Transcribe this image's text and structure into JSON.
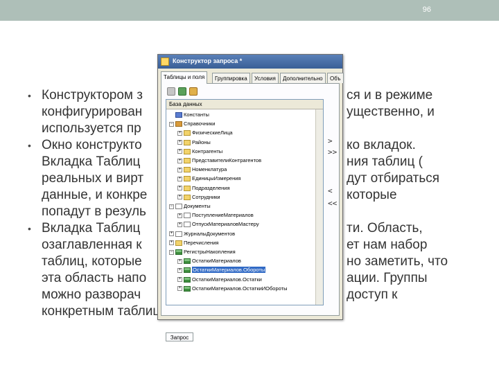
{
  "slide_number": "96",
  "bullets": [
    [
      "Конструктором з",
      "конфигурирован",
      "используется пр"
    ],
    [
      "Окно конструкто",
      "Вкладка Таблиц",
      "реальных и вирт",
      "данные, и конкре",
      "попадут в резуль"
    ],
    [
      "Вкладка Таблиц",
      "озаглавленная к",
      "таблиц, которые",
      "эта область напо",
      "можно разворач",
      "конкретным таблицам."
    ]
  ],
  "bullets_right": [
    [
      "ся и в режиме",
      "ущественно, и",
      ""
    ],
    [
      "ко вкладок.",
      "ния таблиц (",
      "дут отбираться",
      "которые",
      ""
    ],
    [
      "ти. Область,",
      "ет нам набор",
      "но заметить, что",
      "ации. Группы",
      "доступ к",
      ""
    ]
  ],
  "window": {
    "title": "Конструктор запроса *",
    "tabs": [
      "Таблицы и поля",
      "Группировка",
      "Условия",
      "Дополнительно",
      "Объ"
    ],
    "tree_header": "База данных",
    "bottom_tab": "Запрос",
    "tree": [
      {
        "label": "Константы",
        "icon": "const",
        "level": 1,
        "exp": ""
      },
      {
        "label": "Справочники",
        "icon": "book",
        "level": 1,
        "exp": "−"
      },
      {
        "label": "ФизическиеЛица",
        "icon": "folder",
        "level": 2,
        "exp": "+"
      },
      {
        "label": "Районы",
        "icon": "folder",
        "level": 2,
        "exp": "+"
      },
      {
        "label": "Контрагенты",
        "icon": "folder",
        "level": 2,
        "exp": "+"
      },
      {
        "label": "ПредставителиКонтрагентов",
        "icon": "folder",
        "level": 2,
        "exp": "+"
      },
      {
        "label": "Номенклатура",
        "icon": "folder",
        "level": 2,
        "exp": "+"
      },
      {
        "label": "ЕдиницыИзмерения",
        "icon": "folder",
        "level": 2,
        "exp": "+"
      },
      {
        "label": "Подразделения",
        "icon": "folder",
        "level": 2,
        "exp": "+"
      },
      {
        "label": "Сотрудники",
        "icon": "folder",
        "level": 2,
        "exp": "+"
      },
      {
        "label": "Документы",
        "icon": "doc",
        "level": 1,
        "exp": "−"
      },
      {
        "label": "ПоступлениеМатериалов",
        "icon": "doc",
        "level": 2,
        "exp": "+"
      },
      {
        "label": "ОтпускМатериаловМастеру",
        "icon": "doc",
        "level": 2,
        "exp": "+"
      },
      {
        "label": "ЖурналыДокументов",
        "icon": "doc",
        "level": 1,
        "exp": "+"
      },
      {
        "label": "Перечисления",
        "icon": "folder",
        "level": 1,
        "exp": "+"
      },
      {
        "label": "РегистрыНакопления",
        "icon": "reg",
        "level": 1,
        "exp": "−"
      },
      {
        "label": "ОстаткиМатериалов",
        "icon": "reg",
        "level": 2,
        "exp": "+"
      },
      {
        "label": "ОстаткиМатериалов.Обороты",
        "icon": "reg",
        "level": 2,
        "exp": "+",
        "selected": true
      },
      {
        "label": "ОстаткиМатериалов.Остатки",
        "icon": "reg",
        "level": 2,
        "exp": "+"
      },
      {
        "label": "ОстаткиМатериалов.ОстаткиИОбороты",
        "icon": "reg",
        "level": 2,
        "exp": "+"
      }
    ],
    "arrows": [
      ">",
      ">>",
      "<",
      "<<"
    ]
  }
}
